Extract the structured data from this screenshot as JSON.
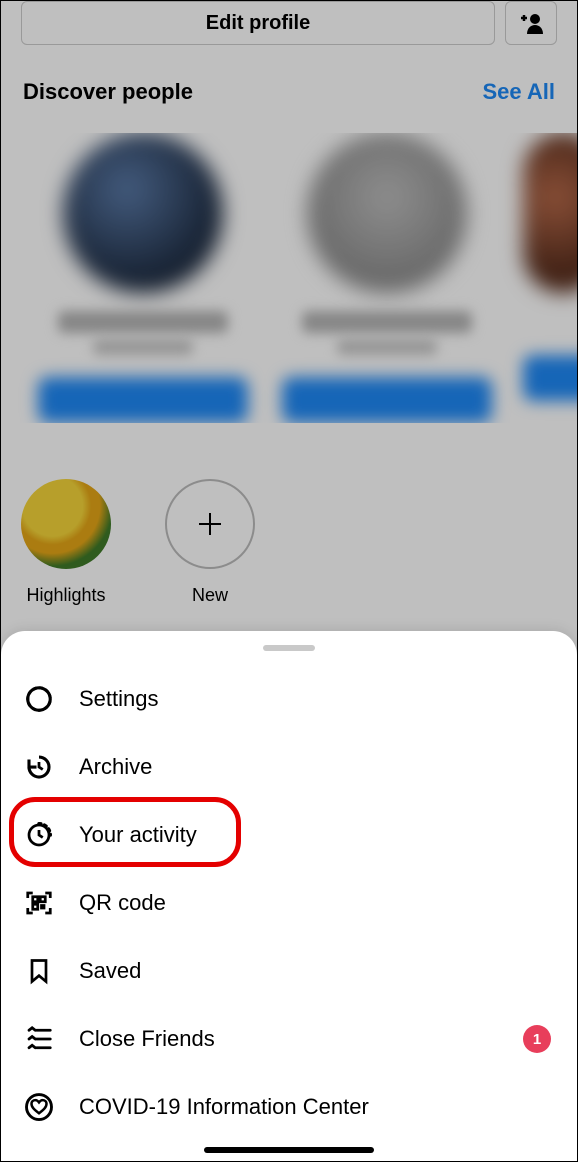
{
  "header": {
    "edit_profile": "Edit profile"
  },
  "discover": {
    "title": "Discover people",
    "see_all": "See All"
  },
  "highlights": {
    "label": "Highlights",
    "new_label": "New"
  },
  "menu": {
    "settings": "Settings",
    "archive": "Archive",
    "your_activity": "Your activity",
    "qr_code": "QR code",
    "saved": "Saved",
    "close_friends": "Close Friends",
    "close_friends_badge": "1",
    "covid": "COVID-19 Information Center"
  }
}
